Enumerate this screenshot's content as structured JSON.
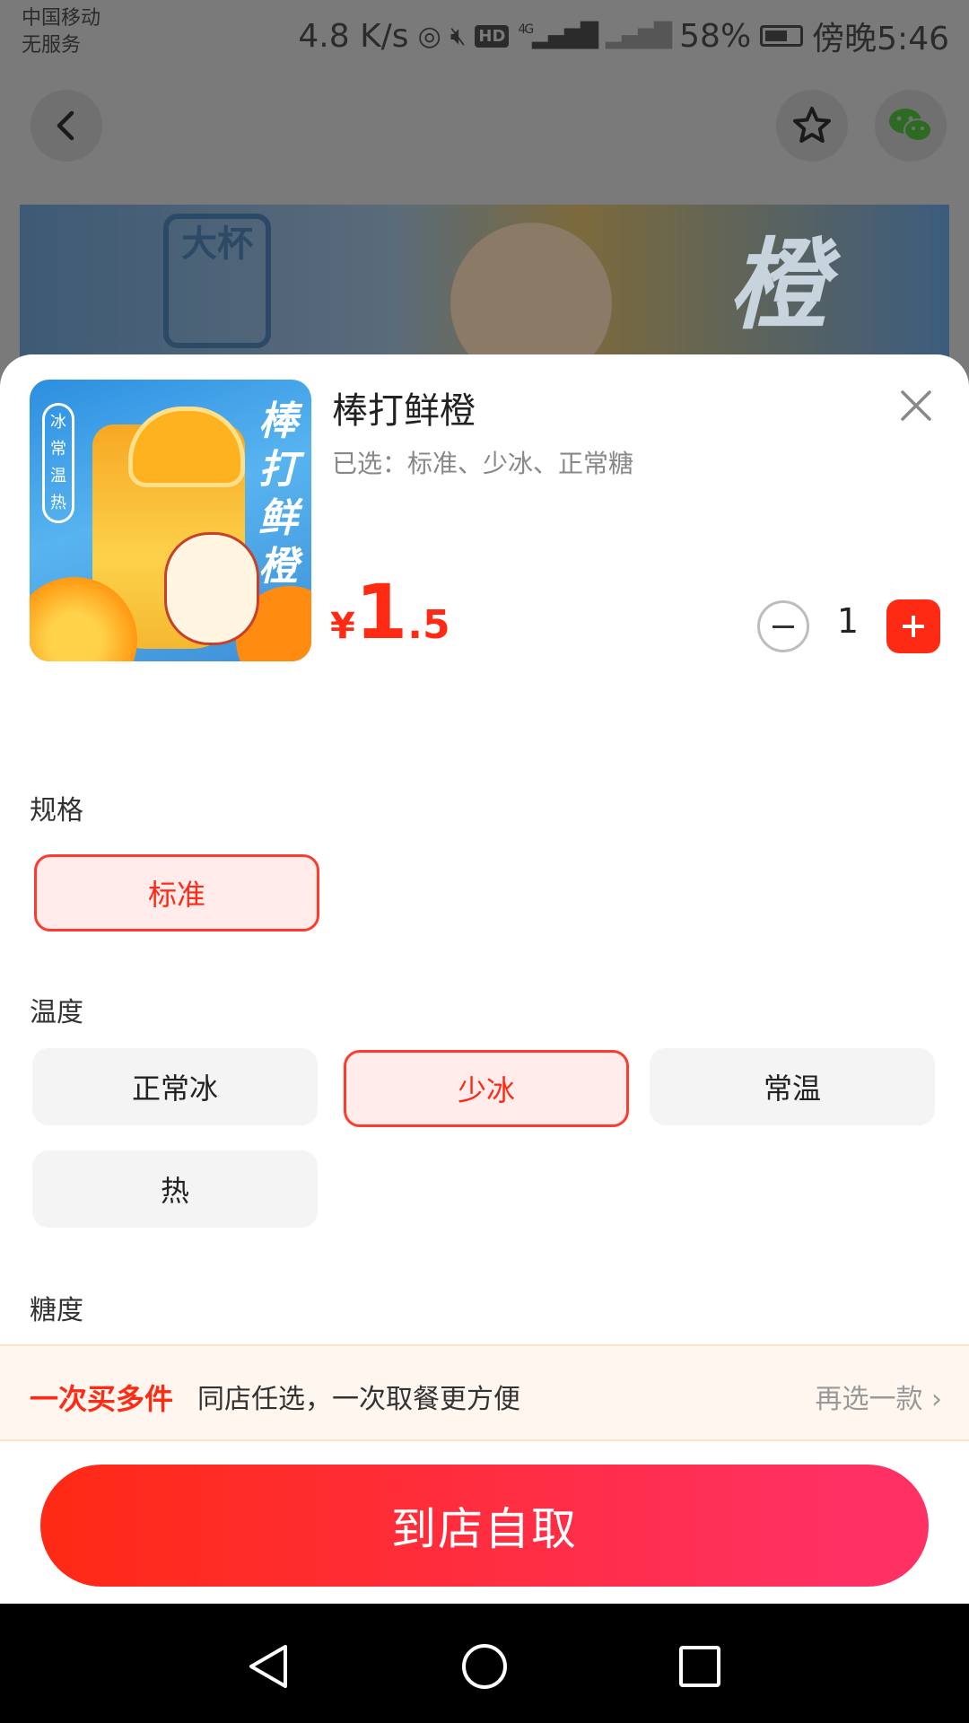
{
  "status_bar": {
    "carrier_line1": "中国移动",
    "carrier_line2": "无服务",
    "net_speed": "4.8 K/s",
    "hd_badge": "HD",
    "network_type": "4G",
    "battery_percent": "58%",
    "time": "傍晚5:46"
  },
  "top_bar": {
    "back_icon": "chevron-left-icon",
    "favorite_icon": "star-icon",
    "share_icon": "wechat-icon"
  },
  "banner": {
    "cup_label": "大杯",
    "title_char": "橙"
  },
  "product": {
    "image_tag": "冰常温热",
    "image_title": "棒打鲜橙",
    "name": "棒打鲜橙",
    "selected_text": "已选：标准、少冰、正常糖",
    "price_symbol": "¥",
    "price_integer": "1",
    "price_decimal": ".5",
    "quantity": "1"
  },
  "sections": {
    "spec_label": "规格",
    "spec_options": [
      "标准"
    ],
    "temp_label": "温度",
    "temp_options": [
      "正常冰",
      "少冰",
      "常温",
      "热"
    ],
    "sugar_label": "糖度"
  },
  "selection": {
    "spec": "标准",
    "temp": "少冰"
  },
  "promo": {
    "title": "一次买多件",
    "desc": "同店任选，一次取餐更方便",
    "link": "再选一款 ›"
  },
  "cta": {
    "label": "到店自取"
  },
  "colors": {
    "accent": "#ff2a14",
    "accent_gradient_end": "#ff3063",
    "selected_bg": "#ffeceb",
    "promo_bg": "#fff7ef"
  }
}
